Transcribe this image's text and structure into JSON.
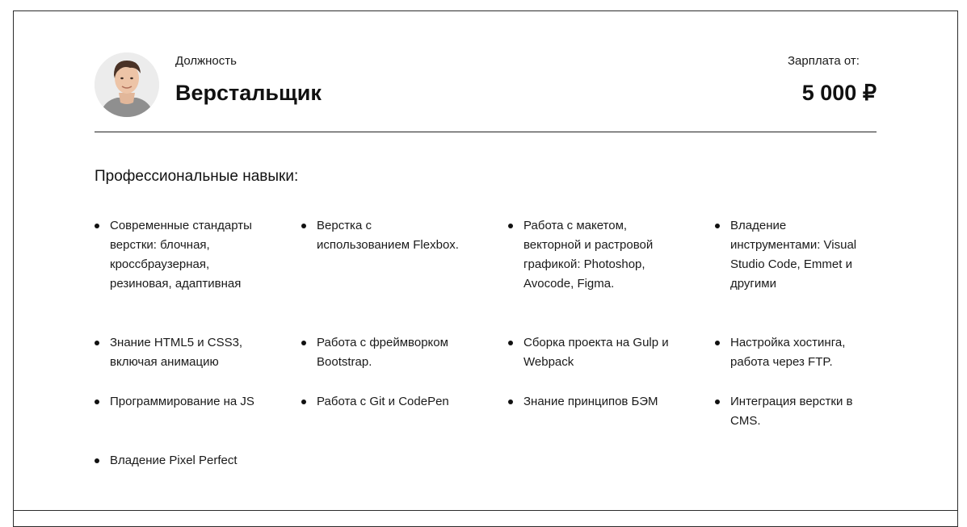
{
  "header": {
    "position_caption": "Должность",
    "job_title": "Верстальщик",
    "salary_caption": "Зарплата от:",
    "salary_value": "5 000 ₽"
  },
  "skills": {
    "heading": "Профессиональные навыки:",
    "items": [
      "Современные стандарты верстки: блочная, кроссбраузерная, резиновая, адаптивная",
      "Верстка с использованием Flexbox.",
      "Работа с макетом, векторной и растровой графикой: Photoshop, Avocode, Figma.",
      "Владение инструментами: Visual Studio Code, Emmet и другими",
      "Знание HTML5 и CSS3, включая анимацию",
      "Работа с фреймворком Bootstrap.",
      "Сборка проекта на Gulp и Webpack",
      "Настройка хостинга, работа через FTP.",
      "Программирование на JS",
      "Работа с Git и CodePen",
      "Знание принципов БЭМ",
      "Интеграция верстки в CMS.",
      "Владение Pixel Perfect"
    ]
  }
}
